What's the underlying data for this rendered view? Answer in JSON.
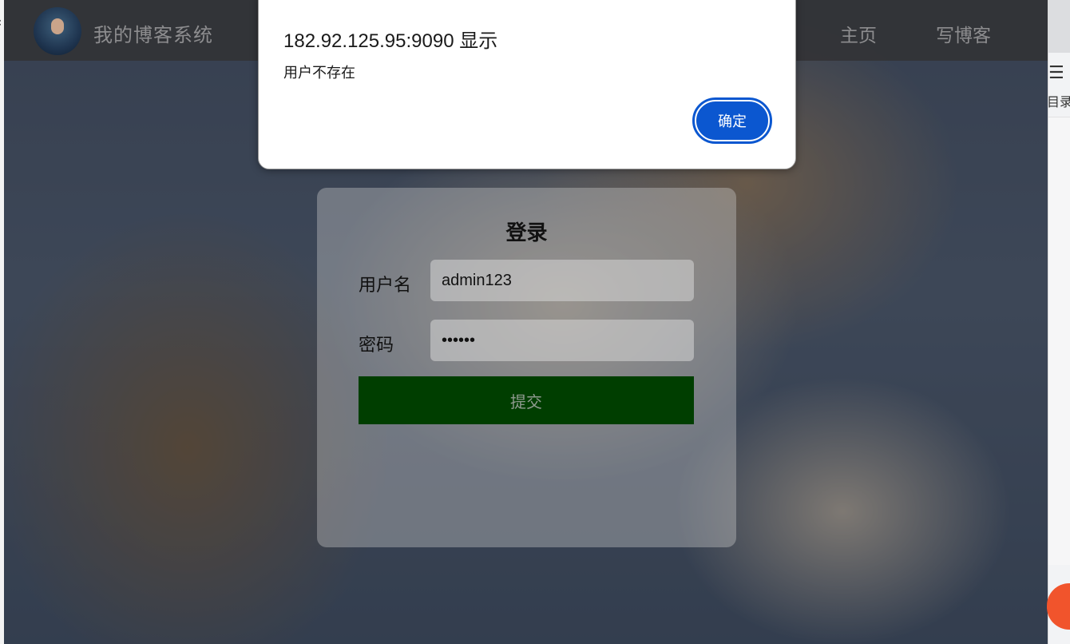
{
  "alert": {
    "origin": "182.92.125.95:9090 显示",
    "message": "用户不存在",
    "ok_label": "确定"
  },
  "header": {
    "site_title": "我的博客系统",
    "nav": {
      "home": "主页",
      "write": "写博客"
    }
  },
  "login": {
    "title": "登录",
    "username_label": "用户名",
    "username_value": "admin123",
    "password_label": "密码",
    "password_value": "••••••",
    "submit_label": "提交"
  },
  "side_panel": {
    "toc_label": "目录",
    "toc_icon": "list-icon"
  },
  "colors": {
    "submit_bg": "#003e00",
    "alert_button": "#0b57d0",
    "navbar_bg": "#323234",
    "fab": "#f1542c"
  }
}
